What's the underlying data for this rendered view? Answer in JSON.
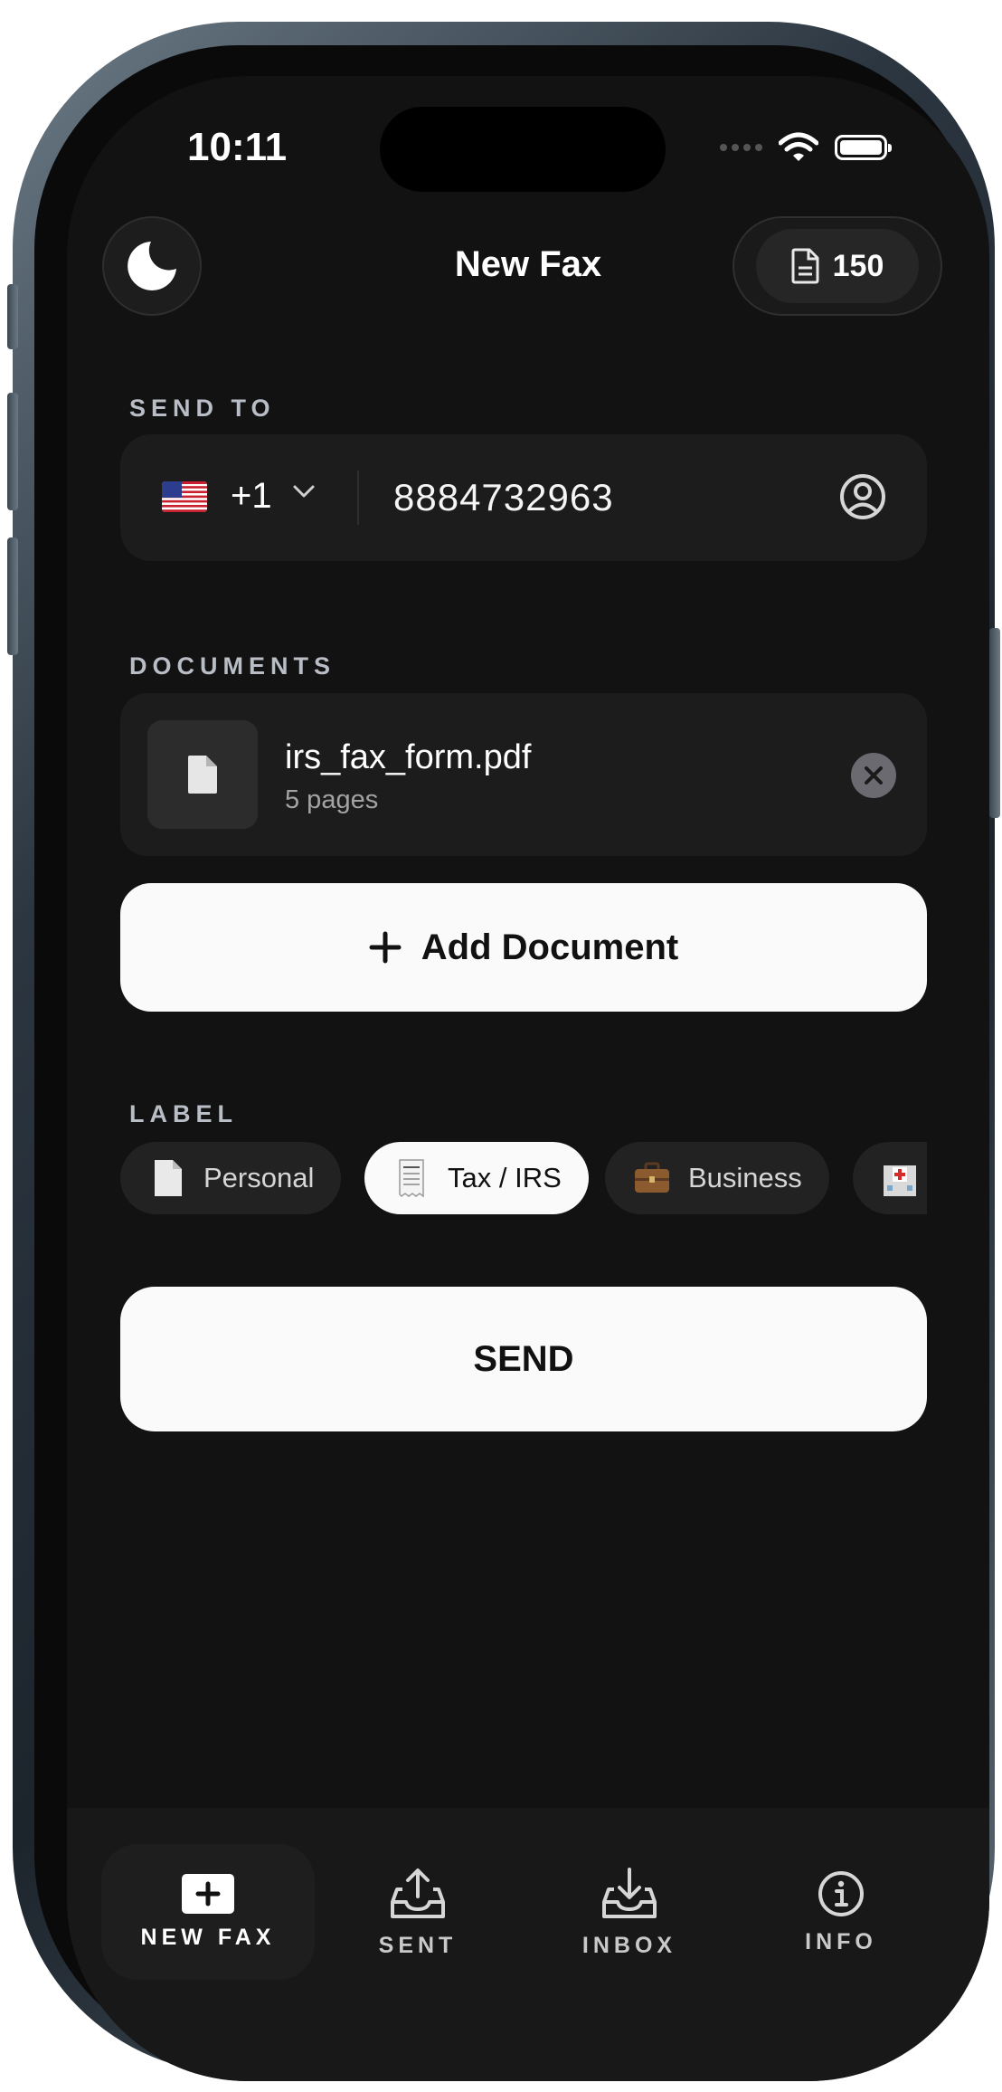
{
  "status_bar": {
    "time": "10:11"
  },
  "header": {
    "title": "New Fax",
    "theme_icon": "moon-icon",
    "credits_icon": "document-icon",
    "credits": "150"
  },
  "send_to": {
    "label": "SEND TO",
    "country_flag": "us-flag",
    "country_code": "+1",
    "phone_number": "8884732963",
    "contact_icon": "contact-icon"
  },
  "documents": {
    "label": "DOCUMENTS",
    "items": [
      {
        "name": "irs_fax_form.pdf",
        "pages": "5 pages"
      }
    ],
    "add_label": "Add Document"
  },
  "label_section": {
    "label": "LABEL",
    "chips": [
      {
        "label": "Personal",
        "icon": "page-emoji",
        "selected": false
      },
      {
        "label": "Tax / IRS",
        "icon": "receipt-emoji",
        "selected": true
      },
      {
        "label": "Business",
        "icon": "briefcase-emoji",
        "selected": false
      },
      {
        "label": "",
        "icon": "hospital-emoji",
        "selected": false
      }
    ]
  },
  "send_button": {
    "label": "SEND"
  },
  "tabbar": {
    "tabs": [
      {
        "label": "NEW FAX",
        "icon": "plus-square-icon",
        "active": true
      },
      {
        "label": "SENT",
        "icon": "tray-up-icon",
        "active": false
      },
      {
        "label": "INBOX",
        "icon": "tray-down-icon",
        "active": false
      },
      {
        "label": "INFO",
        "icon": "info-icon",
        "active": false
      }
    ]
  },
  "colors": {
    "background": "#121212",
    "surface": "#1c1c1c",
    "accent_button": "#fafafa",
    "section_label": "#b9bdc6"
  }
}
